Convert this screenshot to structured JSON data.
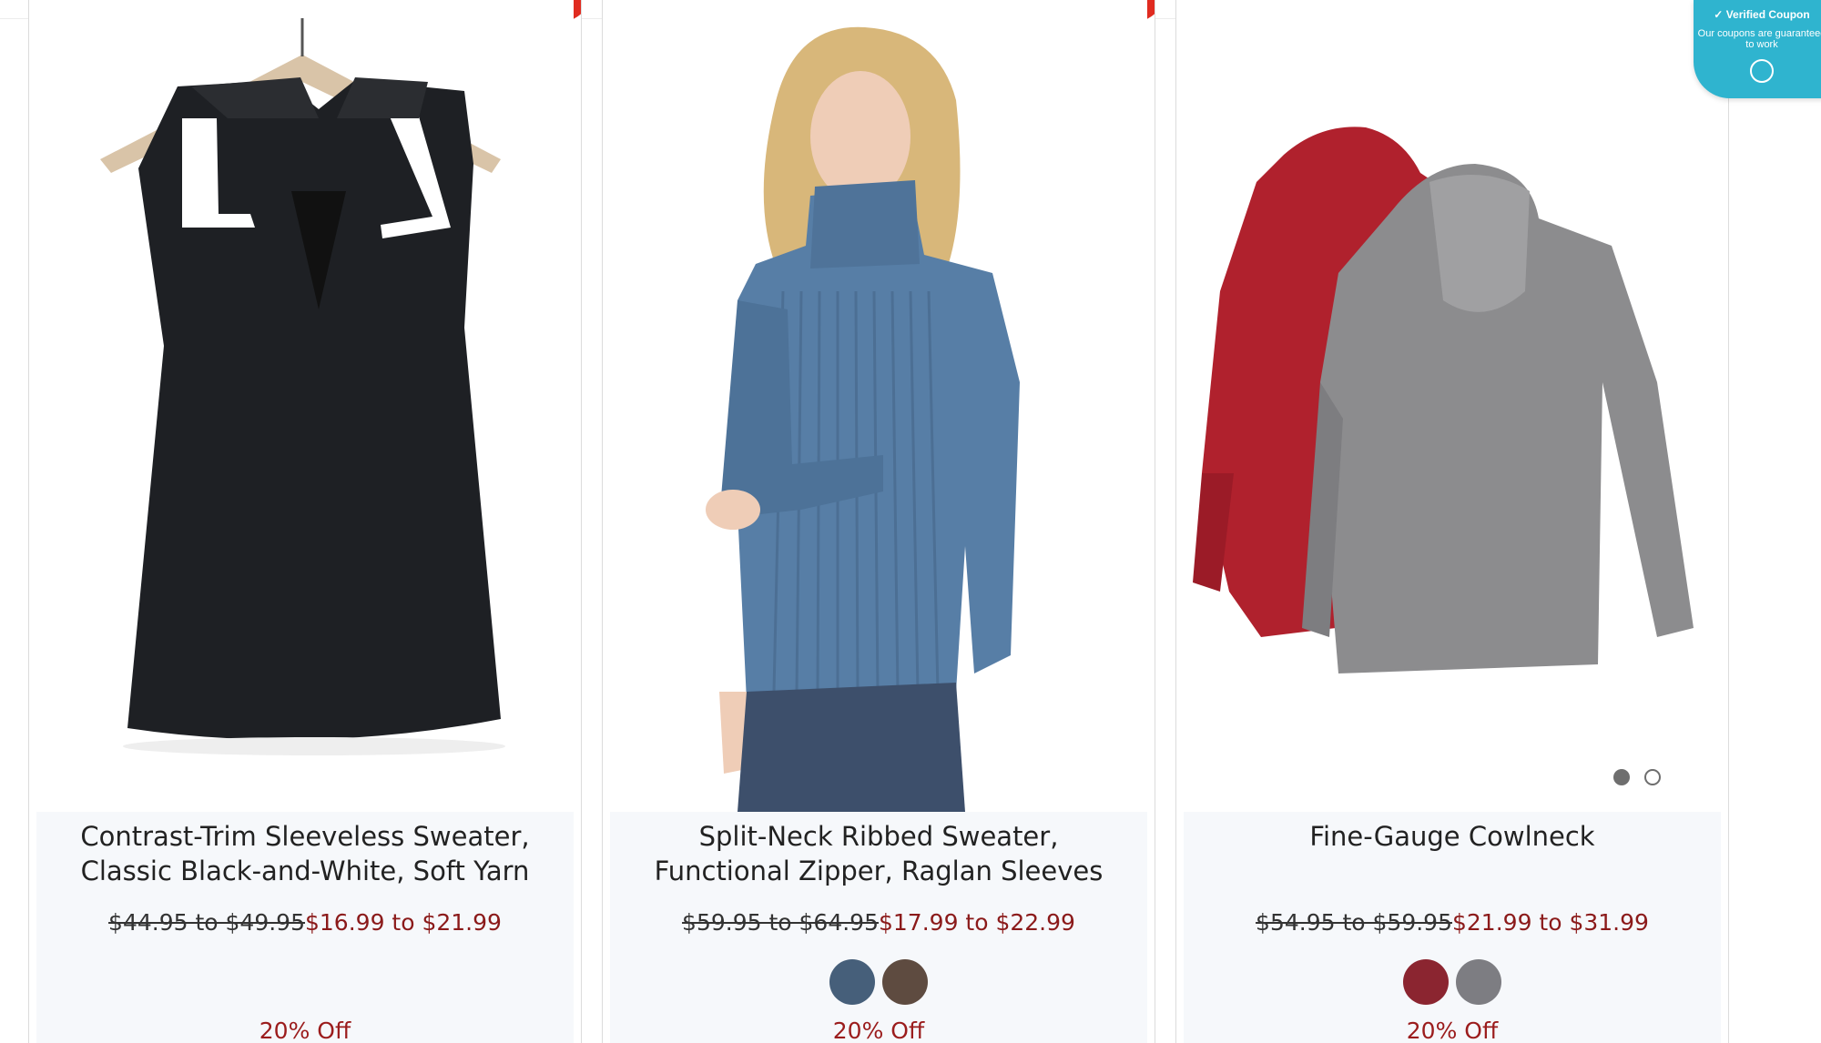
{
  "coupon": {
    "title": "Verified Coupon",
    "subtitle": "Our coupons are guaranteed to work",
    "check_icon": "check-circle-icon",
    "chat_icon": "chat-bubble-icon"
  },
  "products": [
    {
      "title": "Contrast-Trim Sleeveless Sweater, Classic Black-and-White, Soft Yarn",
      "original_price": "$44.95 to $49.95",
      "sale_price": "$16.99 to $21.99",
      "discount": "20% Off",
      "swatches": []
    },
    {
      "title": "Split-Neck Ribbed Sweater, Functional Zipper, Raglan Sleeves",
      "original_price": "$59.95 to $64.95",
      "sale_price": "$17.99 to $22.99",
      "discount": "20% Off",
      "swatches": [
        "#465f7a",
        "#5e4b40"
      ]
    },
    {
      "title": "Fine-Gauge Cowlneck",
      "original_price": "$54.95 to $59.95",
      "sale_price": "$21.99 to $31.99",
      "discount": "20% Off",
      "swatches": [
        "#8b2530",
        "#7d7d82"
      ]
    }
  ],
  "colors": {
    "sale_red": "#8b1a1a",
    "badge_red": "#e02b20",
    "info_bg": "#f6f8fb",
    "coupon_bg": "#2fb4cf"
  }
}
